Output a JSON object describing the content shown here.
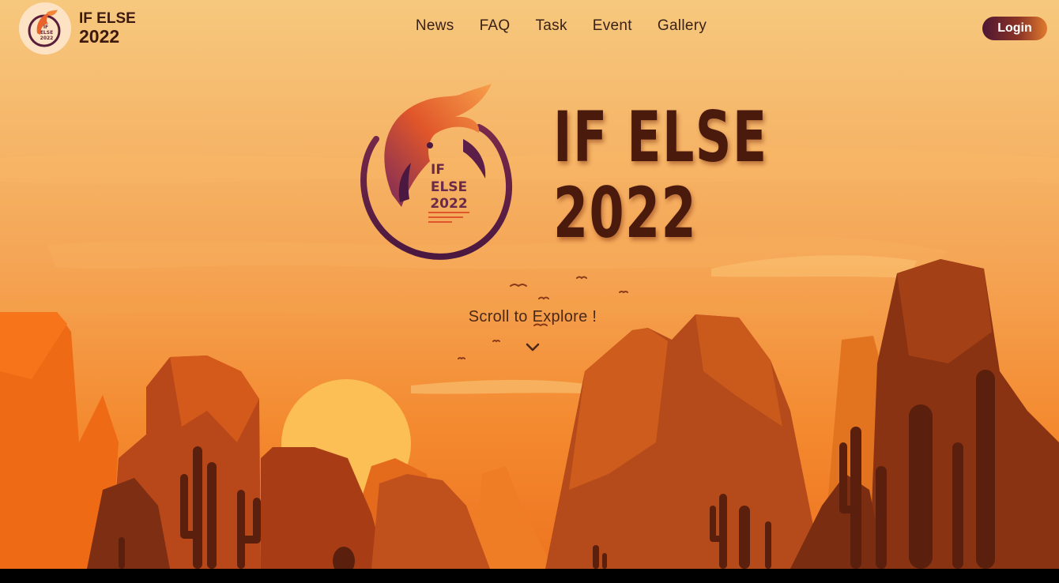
{
  "brand": {
    "line1": "IF ELSE",
    "line2": "2022",
    "logo_icon": "phoenix-logo-icon"
  },
  "nav": {
    "items": [
      {
        "label": "News"
      },
      {
        "label": "FAQ"
      },
      {
        "label": "Task"
      },
      {
        "label": "Event"
      },
      {
        "label": "Gallery"
      }
    ],
    "login_label": "Login"
  },
  "hero": {
    "title_line1": "IF ELSE",
    "title_line2": "2022",
    "logo_text_line1": "IF",
    "logo_text_line2": "ELSE",
    "logo_text_line3": "2022",
    "scroll_text": "Scroll to Explore !",
    "scroll_icon": "chevron-down-icon"
  },
  "colors": {
    "sky_top": "#f5c178",
    "sky_bottom": "#f2852a",
    "rock_dark": "#8a3312",
    "title": "#4a1a0d",
    "login_gradient_start": "#4e1733",
    "login_gradient_end": "#e07a2e"
  }
}
